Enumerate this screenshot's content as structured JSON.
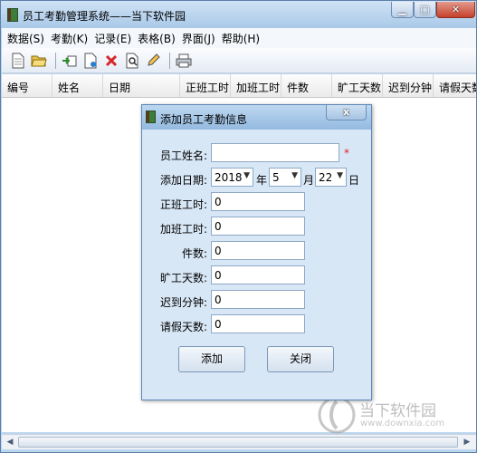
{
  "window": {
    "title": "员工考勤管理系统——当下软件园"
  },
  "menu": [
    "数据(S)",
    "考勤(K)",
    "记录(E)",
    "表格(B)",
    "界面(J)",
    "帮助(H)"
  ],
  "toolbar_icons": [
    "new-icon",
    "open-folder-icon",
    "import-icon",
    "export-icon",
    "delete-icon",
    "find-icon",
    "edit-icon",
    "print-icon"
  ],
  "grid": {
    "columns": [
      "编号",
      "姓名",
      "日期",
      "正班工时",
      "加班工时",
      "件数",
      "旷工天数",
      "迟到分钟",
      "请假天数"
    ]
  },
  "dialog": {
    "title": "添加员工考勤信息",
    "close_label": "x",
    "name_label": "员工姓名:",
    "name_value": "",
    "required_mark": "*",
    "date_label": "添加日期:",
    "year": "2018",
    "year_unit": "年",
    "month": "5",
    "month_unit": "月",
    "day": "22",
    "day_unit": "日",
    "fields": [
      {
        "label": "正班工时:",
        "value": "0"
      },
      {
        "label": "加班工时:",
        "value": "0"
      },
      {
        "label": "件数:",
        "value": "0"
      },
      {
        "label": "旷工天数:",
        "value": "0"
      },
      {
        "label": "迟到分钟:",
        "value": "0"
      },
      {
        "label": "请假天数:",
        "value": "0"
      }
    ],
    "add_button": "添加",
    "close_button": "关闭"
  },
  "watermark": {
    "name": "当下软件园",
    "url": "www.downxia.com"
  }
}
